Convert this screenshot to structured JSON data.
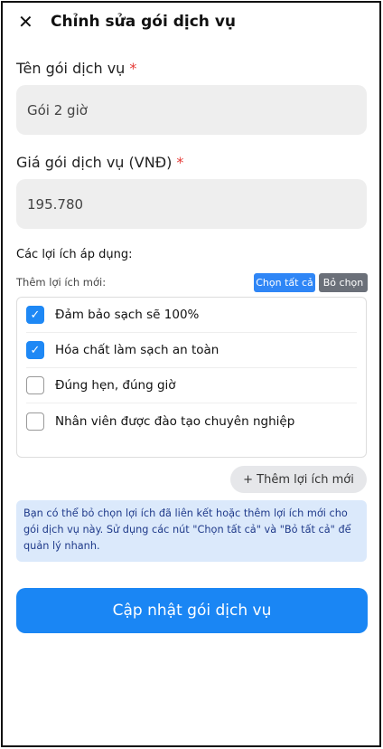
{
  "header": {
    "title": "Chỉnh sửa gói dịch vụ",
    "close_icon": "close-icon"
  },
  "form": {
    "name_label": "Tên gói dịch vụ",
    "name_value": "Gói 2 giờ",
    "price_label": "Giá gói dịch vụ (VNĐ)",
    "price_value": "195.780",
    "required_mark": "*"
  },
  "benefits": {
    "section_label": "Các lợi ích áp dụng:",
    "add_label": "Thêm lợi ích mới:",
    "select_all": "Chọn tất cả",
    "deselect": "Bỏ chọn",
    "items": [
      {
        "label": "Đảm bảo sạch sẽ 100%",
        "checked": true
      },
      {
        "label": "Hóa chất làm sạch an toàn",
        "checked": true
      },
      {
        "label": "Đúng hẹn, đúng giờ",
        "checked": false
      },
      {
        "label": "Nhân viên được đào tạo chuyên nghiệp",
        "checked": false
      }
    ],
    "add_button": "+ Thêm lợi ích mới",
    "info": "Bạn có thể bỏ chọn lợi ích đã liên kết hoặc thêm lợi ích mới cho gói dịch vụ này. Sử dụng các nút \"Chọn tất cả\" và \"Bỏ tất cả\" để quản lý nhanh."
  },
  "submit": "Cập nhật gói dịch vụ",
  "colors": {
    "primary": "#1a86f4",
    "secondary": "#6b7079",
    "info_bg": "#dbe9fb",
    "required": "#e53935"
  }
}
